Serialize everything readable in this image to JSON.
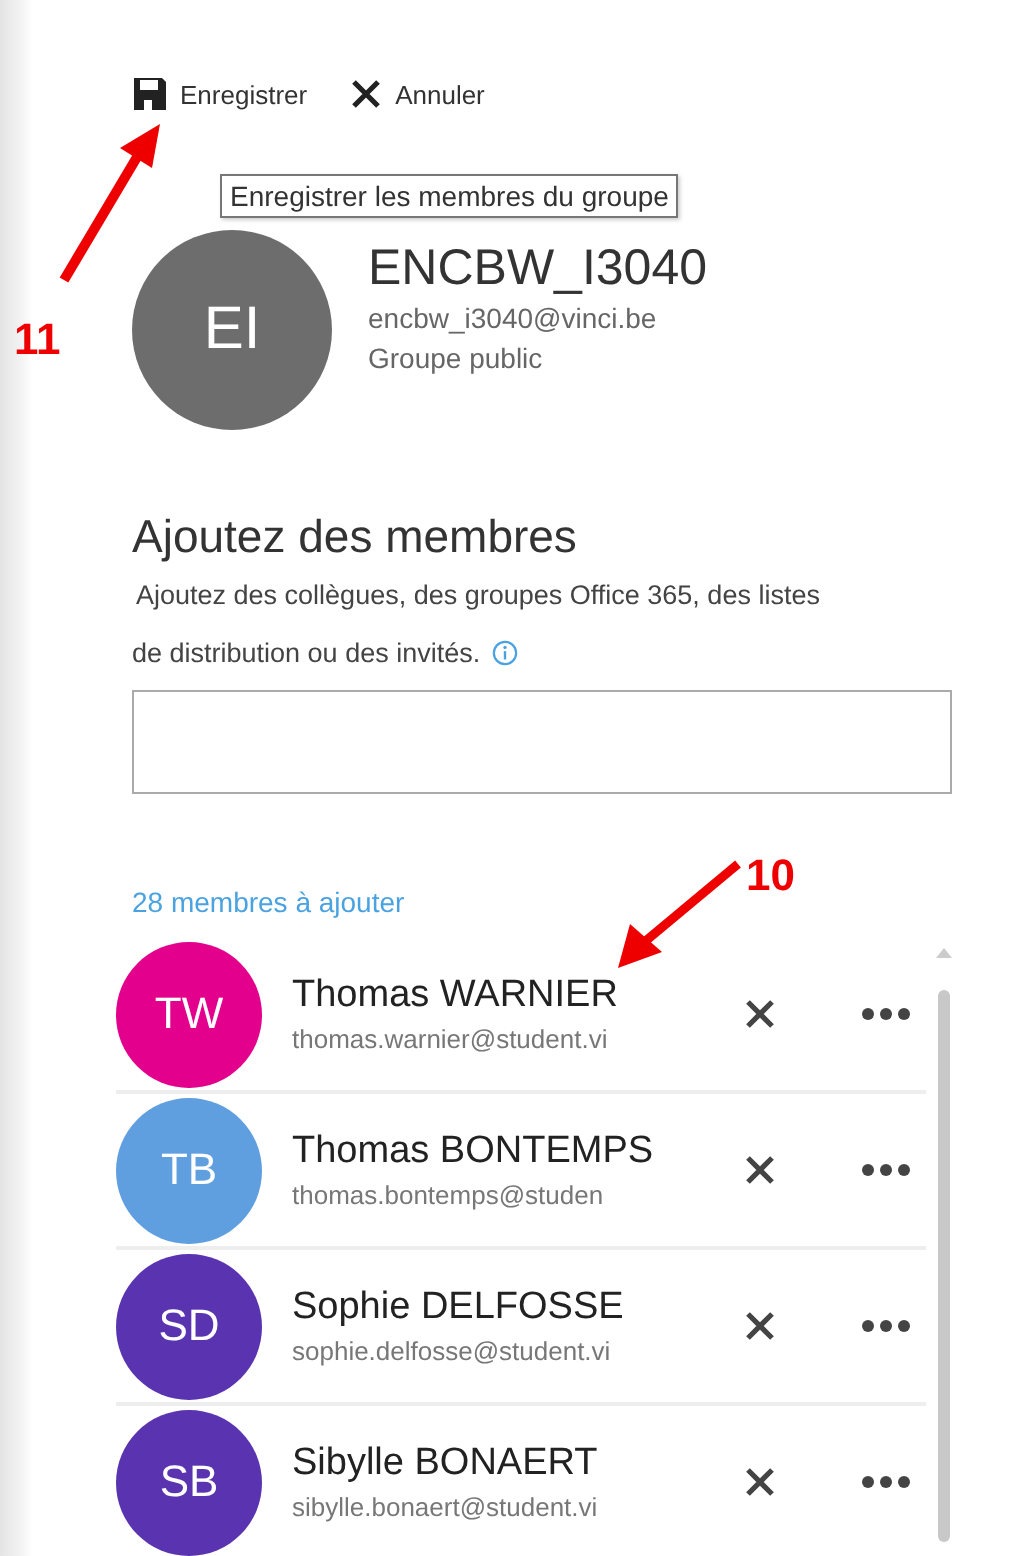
{
  "toolbar": [
    {
      "kind": "save",
      "label": "Enregistrer"
    },
    {
      "kind": "cancel",
      "label": "Annuler"
    }
  ],
  "tooltip": "Enregistrer les membres du groupe",
  "group": {
    "initials": "EI",
    "name": "ENCBW_I3040",
    "email": "encbw_i3040@vinci.be",
    "privacy": "Groupe public"
  },
  "add_members": {
    "heading": "Ajoutez des membres",
    "description_lines": [
      "Ajoutez des collègues, des groupes Office 365, des listes",
      "de distribution ou des invités."
    ],
    "count": "28 membres à ajouter"
  },
  "members": [
    {
      "initials": "TW",
      "name": "Thomas WARNIER",
      "email": "thomas.warnier@student.vi",
      "color": "#e3008c"
    },
    {
      "initials": "TB",
      "name": "Thomas BONTEMPS",
      "email": "thomas.bontemps@studen",
      "color": "#5f9fe0"
    },
    {
      "initials": "SD",
      "name": "Sophie DELFOSSE",
      "email": "sophie.delfosse@student.vi",
      "color": "#5a34b0"
    },
    {
      "initials": "SB",
      "name": "Sibylle BONAERT",
      "email": "sibylle.bonaert@student.vi",
      "color": "#5a34b0"
    }
  ],
  "annotations": [
    {
      "label": "11",
      "kind": "up"
    },
    {
      "label": "10",
      "kind": "down"
    }
  ]
}
